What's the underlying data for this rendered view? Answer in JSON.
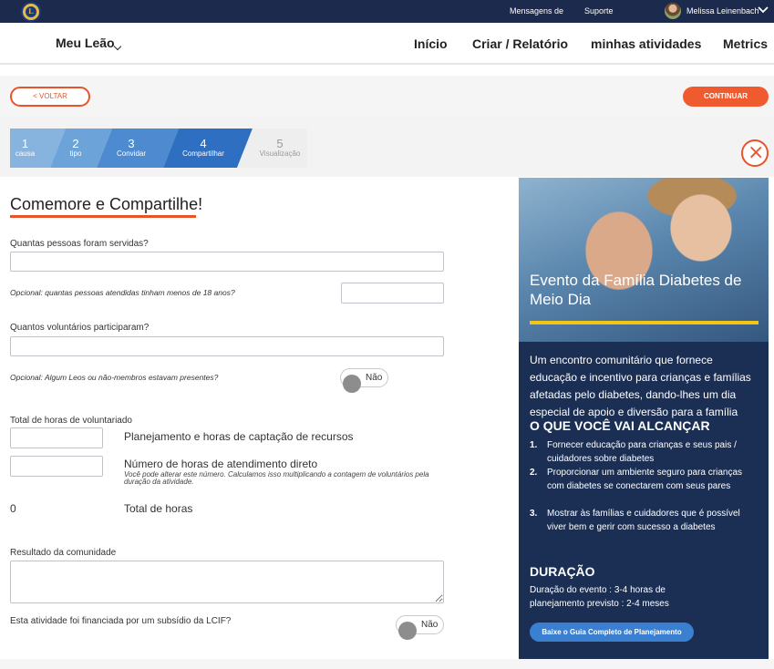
{
  "topbar": {
    "logo_text": "L",
    "links": [
      "Mensagens de",
      "Suporte"
    ],
    "user_name": "Melissa Leinenbach",
    "colors": {
      "background": "#1b2a4d"
    }
  },
  "nav": {
    "brand": "Meu Leão",
    "links": [
      "Início",
      "Criar / Relatório",
      "minhas atividades",
      "Metrics"
    ]
  },
  "actions": {
    "back_label": "< VOLTAR",
    "continue_label": "CONTINUAR",
    "accent": "#ef5b2f"
  },
  "stepper": {
    "steps": [
      {
        "num": "1",
        "label": "causa",
        "state": "done"
      },
      {
        "num": "2",
        "label": "tipo",
        "state": "done"
      },
      {
        "num": "3",
        "label": "Convidar",
        "state": "done"
      },
      {
        "num": "4",
        "label": "Compartilhar",
        "state": "active"
      },
      {
        "num": "5",
        "label": "Visualização",
        "state": "pending"
      }
    ],
    "close_glyph": "×"
  },
  "form": {
    "title": "Comemore e Compartilhe!",
    "people_served_label": "Quantas pessoas foram servidas?",
    "people_under18_label": "Opcional: quantas pessoas atendidas tinham menos de 18 anos?",
    "volunteers_label": "Quantos voluntários participaram?",
    "leos_label": "Opcional: Algum Leos ou não-membros estavam presentes?",
    "leos_toggle": "Não",
    "hours_section_label": "Total de horas de voluntariado",
    "planning_hours_label": "Planejamento e horas de captação de recursos",
    "direct_hours_label": "Número de horas de atendimento direto",
    "direct_hours_note": "Você pode alterar este número. Calculamos isso multiplicando a contagem de voluntários pela duração da atividade.",
    "total_hours_value": "0",
    "total_hours_label": "Total de horas",
    "community_result_label": "Resultado da comunidade",
    "lcif_label": "Esta atividade foi financiada por um subsídio da LCIF?",
    "lcif_toggle": "Não"
  },
  "panel": {
    "title": "Evento da Família Diabetes de Meio Dia",
    "description": "Um encontro comunitário que fornece educação e incentivo para crianças e famílias afetadas pelo diabetes, dando-lhes um dia especial de apoio e diversão para a família",
    "goals_heading": "O QUE VOCÊ VAI ALCANÇAR",
    "goals": [
      {
        "num": "1.",
        "text": "Fornecer educação para crianças e seus pais / cuidadores sobre diabetes"
      },
      {
        "num": "2.",
        "text": "Proporcionar um ambiente seguro para crianças com diabetes se conectarem com seus pares"
      },
      {
        "num": "3.",
        "text": "Mostrar às famílias e cuidadores que é possível viver bem e gerir com sucesso a diabetes"
      }
    ],
    "duration_heading": "DURAÇÃO",
    "duration_event": "Duração do evento : 3-4 horas de",
    "duration_planning": "planejamento previsto : 2-4 meses",
    "guide_button": "Baixe o Guia Completo de Planejamento",
    "colors": {
      "background": "#1b2f55",
      "highlight": "#f3c614",
      "button": "#3b7fd0"
    }
  }
}
